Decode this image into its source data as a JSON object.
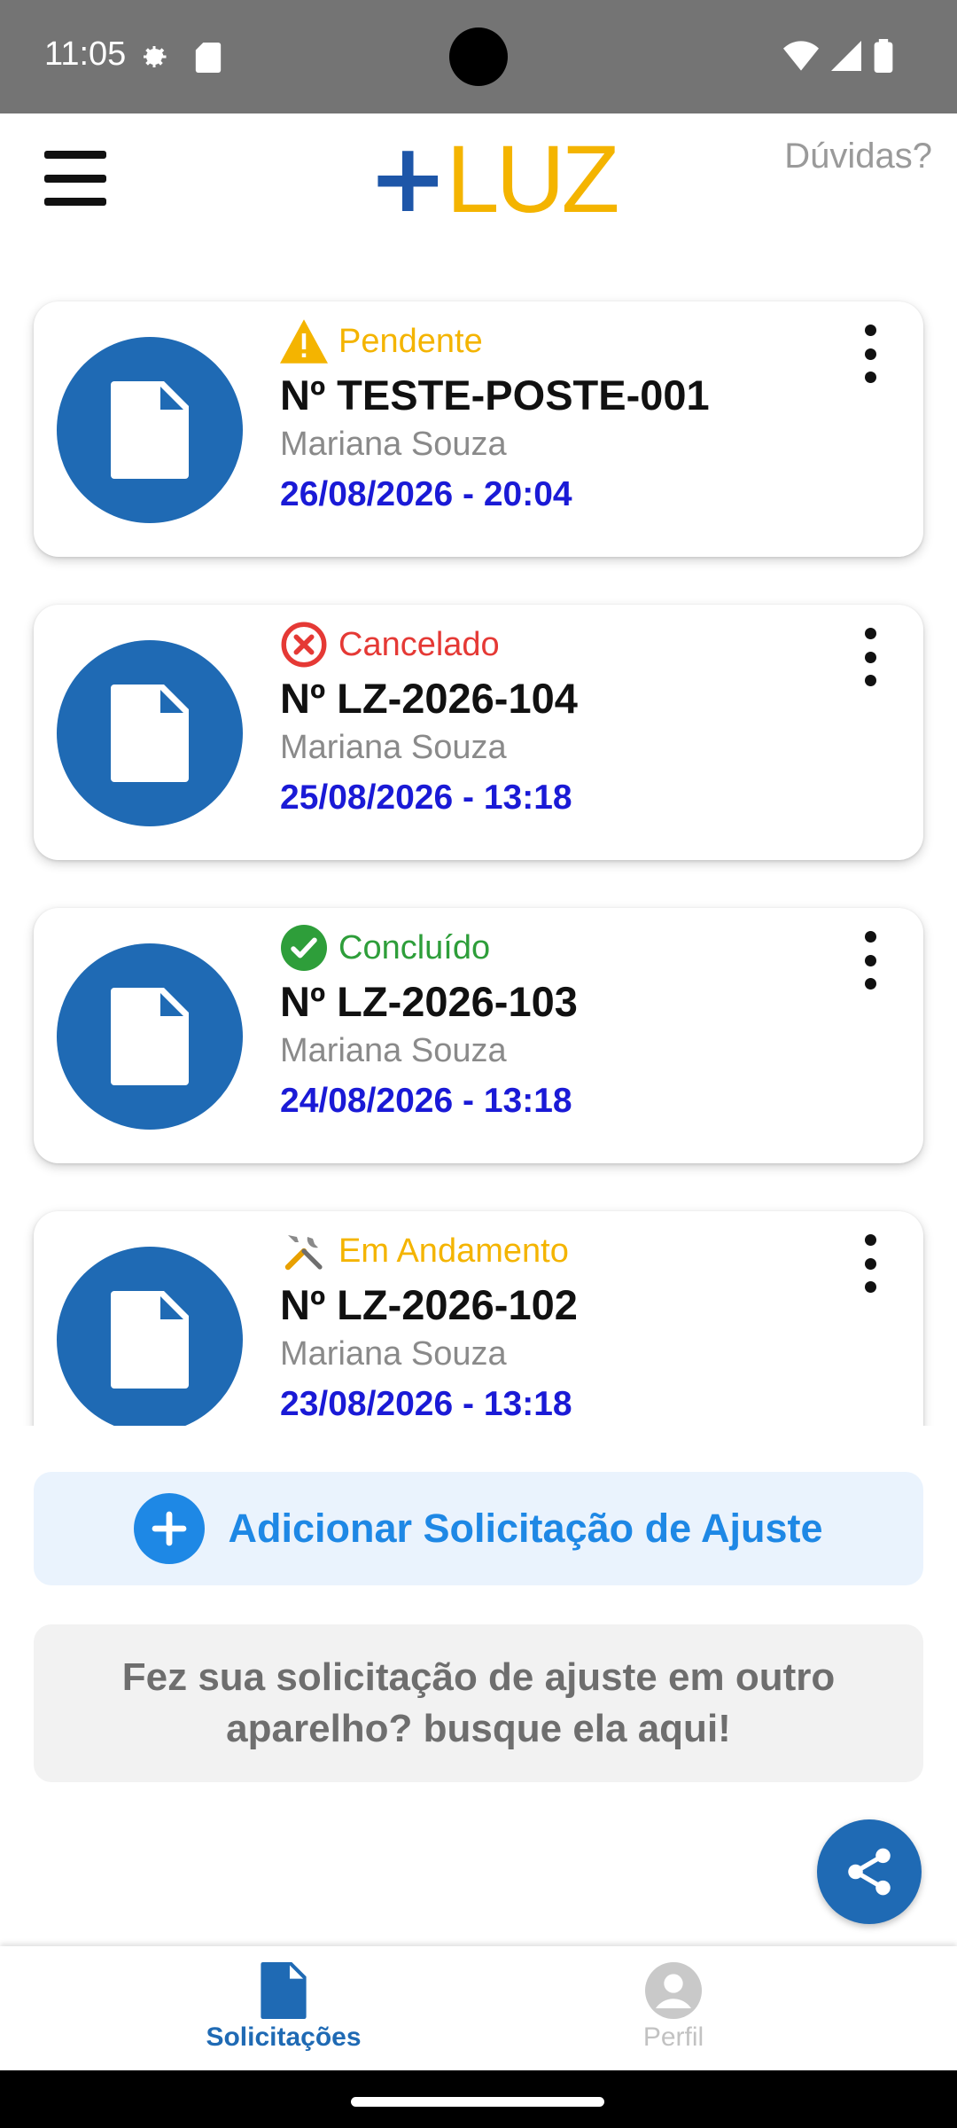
{
  "status_bar": {
    "time": "11:05"
  },
  "header": {
    "logo_plus": "+",
    "logo_text": "LUZ",
    "help_label": "Dúvidas?"
  },
  "requests": [
    {
      "status": "Pendente",
      "status_icon": "warning-icon",
      "status_color": "#f4b400",
      "number": "Nº TESTE-POSTE-001",
      "name": "Mariana Souza",
      "date": "26/08/2026 - 20:04"
    },
    {
      "status": "Cancelado",
      "status_icon": "cancel-circle-icon",
      "status_color": "#e53935",
      "number": "Nº LZ-2026-104",
      "name": "Mariana Souza",
      "date": "25/08/2026 - 13:18"
    },
    {
      "status": "Concluído",
      "status_icon": "check-circle-icon",
      "status_color": "#2e9e3a",
      "number": "Nº LZ-2026-103",
      "name": "Mariana Souza",
      "date": "24/08/2026 - 13:18"
    },
    {
      "status": "Em Andamento",
      "status_icon": "tools-icon",
      "status_color": "#f4b400",
      "number": "Nº LZ-2026-102",
      "name": "Mariana Souza",
      "date": "23/08/2026 - 13:18"
    }
  ],
  "actions": {
    "add_label": "Adicionar Solicitação de Ajuste",
    "search_text": "Fez sua solicitação de ajuste em outro aparelho? busque ela aqui!"
  },
  "bottom_nav": {
    "items": [
      {
        "label": "Solicitações",
        "icon": "document-icon",
        "active": true
      },
      {
        "label": "Perfil",
        "icon": "person-icon",
        "active": false
      }
    ]
  },
  "colors": {
    "primary": "#1f6ab4",
    "accent": "#1e88e5",
    "logo_yellow": "#f4b400",
    "date_blue": "#1a1ad6"
  }
}
